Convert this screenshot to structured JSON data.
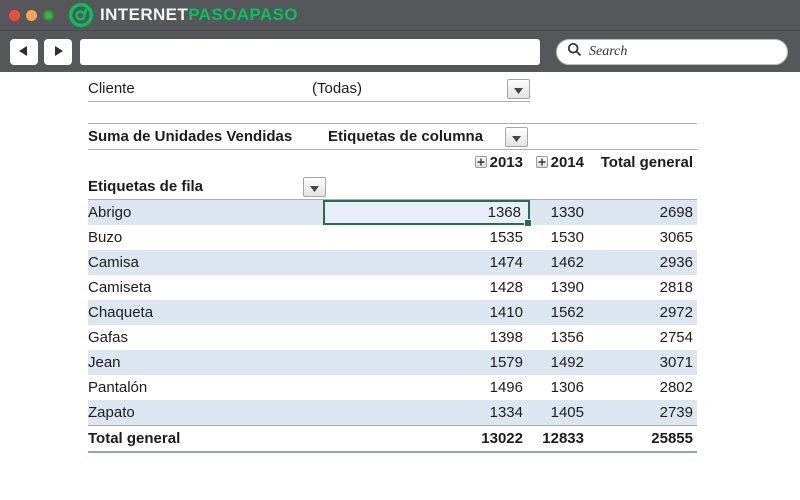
{
  "colors": {
    "chrome_gray": "#56575a",
    "brand_green": "#00c65a",
    "selection_green": "#217346",
    "band_blue": "#dce6f1",
    "border_blue": "#95b3d7",
    "traffic_red": "#f4493f",
    "traffic_orange": "#f6a64e",
    "traffic_green": "#3db24a"
  },
  "titlebar": {
    "brand_primary": "INTERNET",
    "brand_secondary": "PASOAPASO"
  },
  "toolbar": {
    "address_value": "",
    "search_placeholder": "Search"
  },
  "pivot": {
    "filter_label": "Cliente",
    "filter_value": "(Todas)",
    "values_title": "Suma de Unidades Vendidas",
    "columns_title": "Etiquetas de columna",
    "rows_title": "Etiquetas de fila",
    "columns": [
      "2013",
      "2014",
      "Total general"
    ],
    "rows": [
      {
        "label": "Abrigo",
        "values": [
          1368,
          1330,
          2698
        ]
      },
      {
        "label": "Buzo",
        "values": [
          1535,
          1530,
          3065
        ]
      },
      {
        "label": "Camisa",
        "values": [
          1474,
          1462,
          2936
        ]
      },
      {
        "label": "Camiseta",
        "values": [
          1428,
          1390,
          2818
        ]
      },
      {
        "label": "Chaqueta",
        "values": [
          1410,
          1562,
          2972
        ]
      },
      {
        "label": "Gafas",
        "values": [
          1398,
          1356,
          2754
        ]
      },
      {
        "label": "Jean",
        "values": [
          1579,
          1492,
          3071
        ]
      },
      {
        "label": "Pantalón",
        "values": [
          1496,
          1306,
          2802
        ]
      },
      {
        "label": "Zapato",
        "values": [
          1334,
          1405,
          2739
        ]
      }
    ],
    "total_row": {
      "label": "Total general",
      "values": [
        13022,
        12833,
        25855
      ]
    },
    "selected_cell": {
      "row": "Abrigo",
      "column": "2013"
    }
  }
}
